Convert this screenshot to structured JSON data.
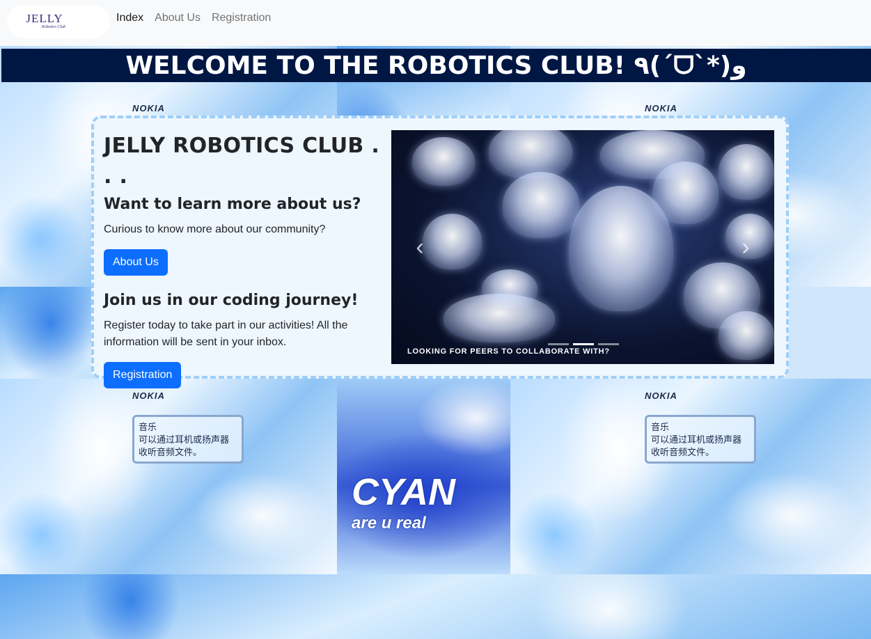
{
  "nav": {
    "brand_main": "JELLY",
    "brand_sub": "Robotics Club",
    "links": [
      "Index",
      "About Us",
      "Registration"
    ]
  },
  "banner": {
    "title": "WELCOME TO THE ROBOTICS CLUB! ٩(ˊᗜˋ*)و"
  },
  "card": {
    "title": "JELLY ROBOTICS CLUB . . .",
    "learn_heading": "Want to learn more about us?",
    "learn_text": "Curious to know more about our community?",
    "about_button": "About Us",
    "join_heading": "Join us in our coding journey!",
    "join_text_line1": "Register today to take part in our activities! All the",
    "join_text_line2": "information will be sent in your inbox.",
    "register_button": "Registration"
  },
  "carousel": {
    "caption": "LOOKING FOR PEERS TO COLLABORATE WITH?",
    "prev_icon": "chevron-left-icon",
    "next_icon": "chevron-right-icon",
    "slide_count": 3,
    "active_slide": 2
  },
  "background": {
    "nokia_label": "NOKIA",
    "screen_line1": "音乐",
    "screen_line2": "可以通过耳机或扬声器",
    "screen_line3": "收听音频文件。",
    "cyan_text": "CYAN",
    "cyan_sub": "are u real"
  },
  "colors": {
    "banner_bg": "#001744",
    "button_bg": "#0d6efd",
    "card_border": "#9fcff8",
    "card_bg": "#eef6fe"
  }
}
